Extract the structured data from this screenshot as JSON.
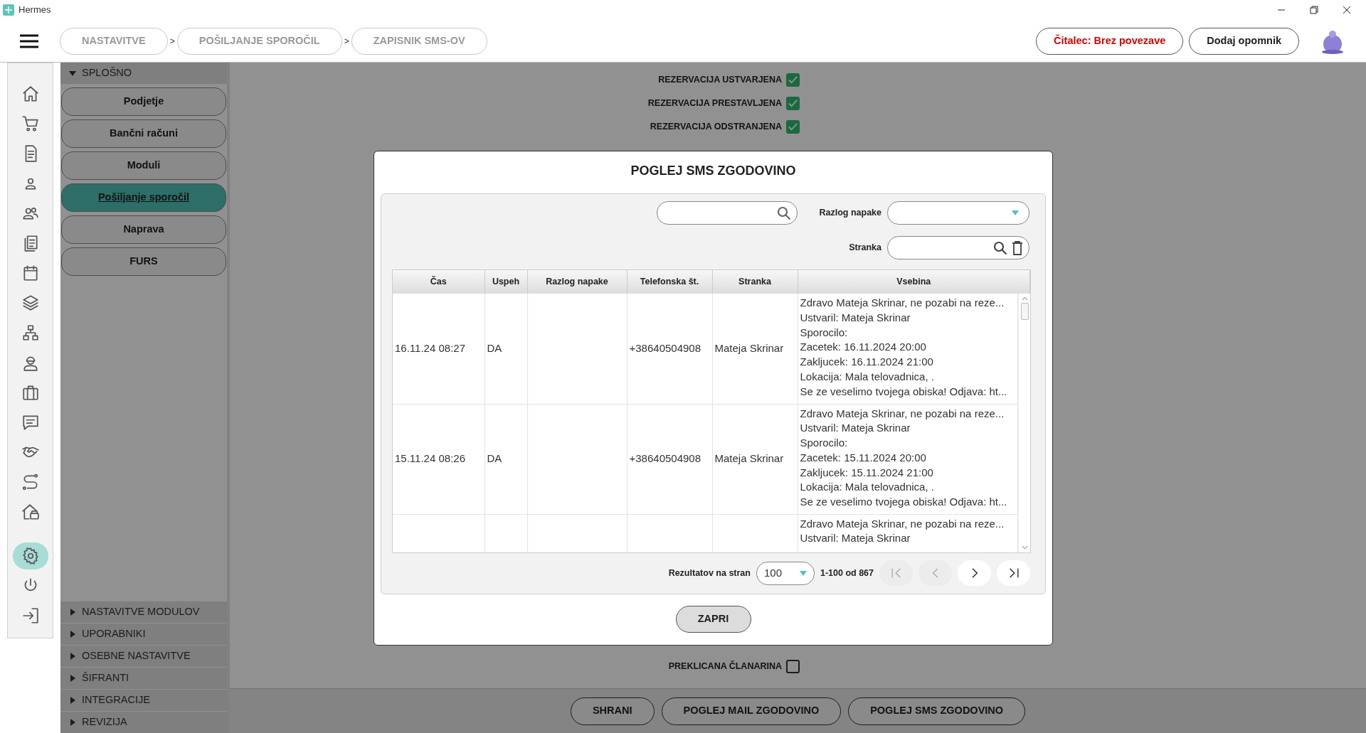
{
  "window": {
    "title": "Hermes"
  },
  "breadcrumbs": [
    {
      "label": "NASTAVITVE"
    },
    {
      "label": "POŠILJANJE SPOROČIL"
    },
    {
      "label": "ZAPISNIK SMS-OV"
    }
  ],
  "breadcrumb_separators": [
    ">",
    ">"
  ],
  "header_buttons": [
    {
      "label": "Čitalec: Brez povezave",
      "kind": "alert"
    },
    {
      "label": "Dodaj opomnik",
      "kind": "normal"
    }
  ],
  "icon_bar": [
    {
      "selected": false
    },
    {
      "selected": false
    },
    {
      "selected": false
    },
    {
      "selected": false
    },
    {
      "selected": false
    },
    {
      "selected": false
    },
    {
      "selected": false
    },
    {
      "selected": false
    },
    {
      "selected": false
    },
    {
      "selected": false
    },
    {
      "selected": false
    },
    {
      "selected": false
    },
    {
      "selected": false
    },
    {
      "selected": false
    },
    {
      "selected": false
    },
    {
      "selected": true
    },
    {
      "selected": false
    },
    {
      "selected": false
    }
  ],
  "settings_menu": [
    {
      "label": "SPLOŠNO",
      "expanded": true,
      "items": [
        {
          "label": "Podjetje",
          "selected": false
        },
        {
          "label": "Bančni računi",
          "selected": false
        },
        {
          "label": "Moduli",
          "selected": false
        },
        {
          "label": "Pošiljanje sporočil",
          "selected": true
        },
        {
          "label": "Naprava",
          "selected": false
        },
        {
          "label": "FURS",
          "selected": false
        }
      ]
    },
    {
      "label": "NASTAVITVE MODULOV",
      "expanded": false
    },
    {
      "label": "UPORABNIKI",
      "expanded": false
    },
    {
      "label": "OSEBNE NASTAVITVE",
      "expanded": false
    },
    {
      "label": "ŠIFRANTI",
      "expanded": false
    },
    {
      "label": "INTEGRACIJE",
      "expanded": false
    },
    {
      "label": "REVIZIJA",
      "expanded": false
    }
  ],
  "settings_top": [
    {
      "label": "REZERVACIJA USTVARJENA",
      "checked": true
    },
    {
      "label": "REZERVACIJA PRESTAVLJENA",
      "checked": true
    },
    {
      "label": "REZERVACIJA ODSTRANJENA",
      "checked": true
    }
  ],
  "settings_bottom": [
    {
      "label": "PREKLICANA ČLANARINA",
      "checked": false
    }
  ],
  "footer_buttons": [
    "SHRANI",
    "POGLEJ MAIL ZGODOVINO",
    "POGLEJ SMS ZGODOVINO"
  ],
  "dialog": {
    "title": "POGLEJ SMS ZGODOVINO",
    "filters": {
      "error_reason_label": "Razlog napake",
      "customer_label": "Stranka"
    },
    "table": {
      "columns": [
        "Čas",
        "Uspeh",
        "Razlog napake",
        "Telefonska št.",
        "Stranka",
        "Vsebina"
      ],
      "rows": [
        {
          "time": "16.11.24 08:27",
          "success": "DA",
          "phone": "+38640504908",
          "customer": "Mateja Skrinar",
          "content": [
            "Zdravo Mateja Skrinar, ne pozabi na reze...",
            "Ustvaril: Mateja Skrinar",
            "Sporocilo:",
            "Zacetek: 16.11.2024 20:00",
            "Zakljucek: 16.11.2024 21:00",
            "Lokacija: Mala telovadnica, .",
            "Se ze veselimo tvojega obiska! Odjava: ht..."
          ]
        },
        {
          "time": "15.11.24 08:26",
          "success": "DA",
          "phone": "+38640504908",
          "customer": "Mateja Skrinar",
          "content": [
            "Zdravo Mateja Skrinar, ne pozabi na reze...",
            "Ustvaril: Mateja Skrinar",
            "Sporocilo:",
            "Zacetek: 15.11.2024 20:00",
            "Zakljucek: 15.11.2024 21:00",
            "Lokacija: Mala telovadnica, .",
            "Se ze veselimo tvojega obiska! Odjava: ht..."
          ]
        },
        {
          "content": [
            "Zdravo Mateja Skrinar, ne pozabi na reze...",
            "Ustvaril: Mateja Skrinar"
          ]
        }
      ]
    },
    "pagination": {
      "label": "Rezultatov na stran",
      "per_page": "100",
      "range": "1-100 od 867",
      "buttons": [
        {
          "disabled": true
        },
        {
          "disabled": true
        },
        {
          "disabled": false
        },
        {
          "disabled": false
        }
      ]
    },
    "close_button": "ZAPRI"
  }
}
